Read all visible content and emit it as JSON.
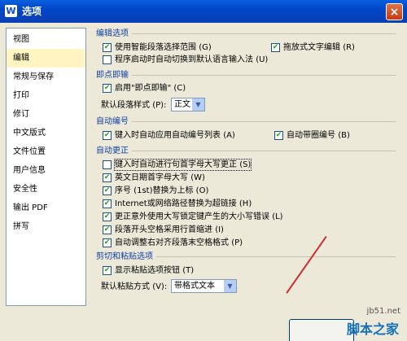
{
  "window": {
    "icon_glyph": "W",
    "title": "选项",
    "close_glyph": "×"
  },
  "sidebar": {
    "items": [
      {
        "label": "视图",
        "selected": false
      },
      {
        "label": "编辑",
        "selected": true
      },
      {
        "label": "常规与保存",
        "selected": false
      },
      {
        "label": "打印",
        "selected": false
      },
      {
        "label": "修订",
        "selected": false
      },
      {
        "label": "中文版式",
        "selected": false
      },
      {
        "label": "文件位置",
        "selected": false
      },
      {
        "label": "用户信息",
        "selected": false
      },
      {
        "label": "安全性",
        "selected": false
      },
      {
        "label": "输出 PDF",
        "selected": false
      },
      {
        "label": "拼写",
        "selected": false
      }
    ]
  },
  "sections": {
    "edit": {
      "title": "编辑选项",
      "smart_select": {
        "label": "使用智能段落选择范围",
        "key": "(G)",
        "checked": true
      },
      "drag_edit": {
        "label": "拖放式文字编辑",
        "key": "(R)",
        "checked": true
      },
      "auto_ime": {
        "label": "程序启动时自动切换到默认语言输入法",
        "key": "(U)",
        "checked": false
      }
    },
    "click_type": {
      "title": "即点即输",
      "enable": {
        "label": "启用\"即点即输\"",
        "key": "(C)",
        "checked": true
      },
      "default_style_label": "默认段落样式",
      "default_style_key": "(P):",
      "default_style_value": "正文"
    },
    "auto_number": {
      "title": "自动编号",
      "apply_list": {
        "label": "键入时自动应用自动编号列表",
        "key": "(A)",
        "checked": true
      },
      "circle_number": {
        "label": "自动带圈编号",
        "key": "(B)",
        "checked": true
      }
    },
    "auto_correct": {
      "title": "自动更正",
      "capitalize": {
        "label": "键入时自动进行句首字母大写更正",
        "key": "(S)",
        "checked": false
      },
      "english_date": {
        "label": "英文日期首字母大写",
        "key": "(W)",
        "checked": true
      },
      "ordinal": {
        "label": "序号 (1st)替换为上标",
        "key": "(O)",
        "checked": true
      },
      "hyperlink": {
        "label": "Internet或网络路径替换为超链接",
        "key": "(H)",
        "checked": true
      },
      "caps_lock": {
        "label": "更正意外使用大写锁定键产生的大小写错误",
        "key": "(L)",
        "checked": true
      },
      "first_indent": {
        "label": "段落开头空格采用行首缩进",
        "key": "(I)",
        "checked": true
      },
      "adjust_trailing": {
        "label": "自动调整右对齐段落末空格格式",
        "key": "(P)",
        "checked": true
      }
    },
    "cut_paste": {
      "title": "剪切和粘贴选项",
      "show_paste_btn": {
        "label": "显示粘贴选项按钮",
        "key": "(T)",
        "checked": true
      },
      "default_paste_label": "默认粘贴方式",
      "default_paste_key": "(V):",
      "default_paste_value": "带格式文本"
    }
  },
  "watermark": {
    "site": "jb51.net",
    "brand": "脚本之家"
  },
  "colors": {
    "titlebar": "#0a5fdc",
    "section_title": "#0f3fa6",
    "selected_nav": "#fff4c2",
    "check": "#21a121"
  },
  "check_glyph": "✔",
  "dropdown_arrow_glyph": "▼"
}
